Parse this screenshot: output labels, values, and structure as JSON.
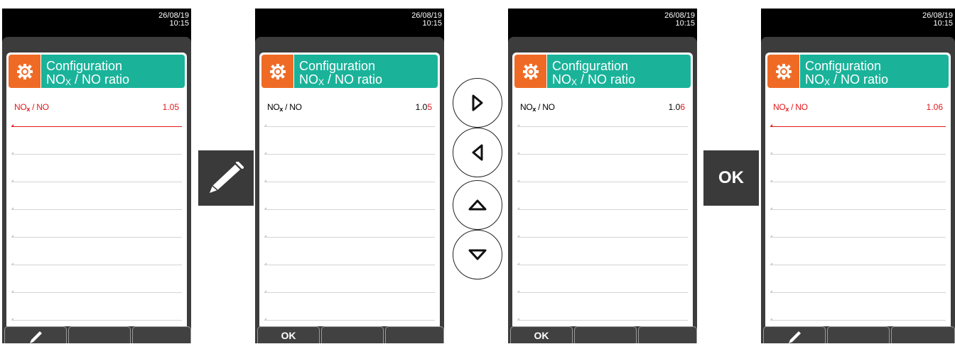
{
  "screens": [
    {
      "date": "26/08/19",
      "time": "10:15",
      "title_line1": "Configuration",
      "title_nox": "NO",
      "title_sub": "X",
      "title_rest": " / NO ratio",
      "row_label_main": "NO",
      "row_label_sub": "x",
      "row_label_rest": " / NO",
      "value_a": "1.05",
      "value_b": "",
      "softkey_1": ""
    },
    {
      "date": "26/08/19",
      "time": "10:15",
      "title_line1": "Configuration",
      "title_nox": "NO",
      "title_sub": "X",
      "title_rest": " / NO ratio",
      "row_label_main": "NO",
      "row_label_sub": "x",
      "row_label_rest": " / NO",
      "value_a": "1.0",
      "value_b": "5",
      "softkey_1": "OK"
    },
    {
      "date": "26/08/19",
      "time": "10:15",
      "title_line1": "Configuration",
      "title_nox": "NO",
      "title_sub": "X",
      "title_rest": " / NO ratio",
      "row_label_main": "NO",
      "row_label_sub": "x",
      "row_label_rest": " / NO",
      "value_a": "1.0",
      "value_b": "6",
      "softkey_1": "OK"
    },
    {
      "date": "26/08/19",
      "time": "10:15",
      "title_line1": "Configuration",
      "title_nox": "NO",
      "title_sub": "X",
      "title_rest": " / NO ratio",
      "row_label_main": "NO",
      "row_label_sub": "x",
      "row_label_rest": " / NO",
      "value_a": "1.06",
      "value_b": "",
      "softkey_1": ""
    }
  ],
  "ok_tile_label": "OK",
  "icons": [
    "gear-icon",
    "pencil-icon",
    "arrow-right-icon",
    "arrow-left-icon",
    "arrow-up-icon",
    "arrow-down-icon"
  ],
  "colors": {
    "header_orange": "#ef6b25",
    "header_teal": "#1ab39a",
    "selected_red": "#e4161b",
    "device_gray": "#3c3c3c"
  }
}
